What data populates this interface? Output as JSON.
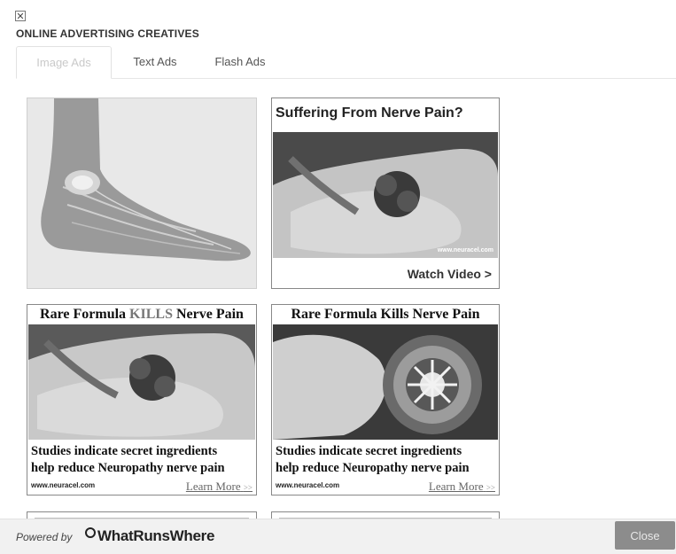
{
  "header": {
    "close_glyph": "✕",
    "title": "ONLINE ADVERTISING CREATIVES"
  },
  "tabs": [
    {
      "label": "Image Ads",
      "active": true
    },
    {
      "label": "Text Ads",
      "active": false
    },
    {
      "label": "Flash Ads",
      "active": false
    }
  ],
  "ads": {
    "ad2": {
      "headline": "Suffering From Nerve Pain?",
      "url": "www.neuracel.com",
      "cta": "Watch Video >"
    },
    "ad3": {
      "headline_pre": "Rare Formula ",
      "headline_em": "KILLS",
      "headline_post": " Nerve Pain",
      "body1": "Studies indicate secret ingredients",
      "body2": "help reduce Neuropathy nerve pain",
      "url": "www.neuracel.com",
      "cta": "Learn More",
      "cta_arrow": ">>"
    },
    "ad4": {
      "headline": "Rare Formula Kills Nerve Pain",
      "body1": "Studies indicate secret ingredients",
      "body2": "help reduce Neuropathy nerve pain",
      "url": "www.neuracel.com",
      "cta": "Learn More",
      "cta_arrow": ">>"
    }
  },
  "footer": {
    "powered_by": "Powered by",
    "brand": "WhatRunsWhere",
    "close_label": "Close"
  }
}
